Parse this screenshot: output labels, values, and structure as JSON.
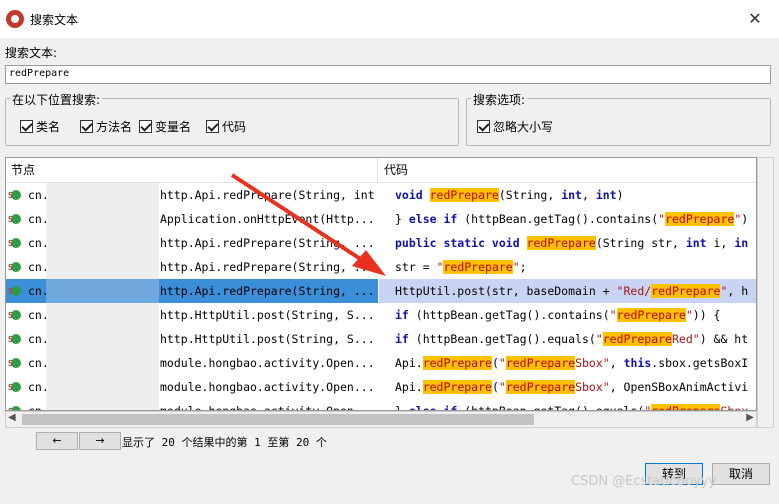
{
  "window": {
    "title": "搜索文本",
    "close_glyph": "✕",
    "icon": "jadx-app-icon"
  },
  "search": {
    "label": "搜索文本:",
    "value": "redPrepare"
  },
  "location_group": {
    "legend": "在以下位置搜索:",
    "options": [
      {
        "label": "类名",
        "checked": true
      },
      {
        "label": "方法名",
        "checked": true
      },
      {
        "label": "变量名",
        "checked": true
      },
      {
        "label": "代码",
        "checked": true
      }
    ]
  },
  "options_group": {
    "legend": "搜索选项:",
    "options": [
      {
        "label": "忽略大小写",
        "checked": true
      }
    ]
  },
  "results": {
    "col_node": "节点",
    "col_code": "代码",
    "rows": [
      {
        "prefix": "cn.",
        "method": "http.Api.redPrepare(String, int",
        "code": [
          [
            "kw",
            "void "
          ],
          [
            "hl",
            "redPrepare"
          ],
          [
            "t",
            "(String, "
          ],
          [
            "kw",
            "int"
          ],
          [
            "t",
            ", "
          ],
          [
            "kw",
            "int"
          ],
          [
            "t",
            ")"
          ]
        ]
      },
      {
        "prefix": "cn.",
        "method": "Application.onHttpEvent(Http...",
        "code": [
          [
            "t",
            "} "
          ],
          [
            "kw",
            "else if"
          ],
          [
            "t",
            " (httpBean.getTag().contains("
          ],
          [
            "str",
            "\""
          ],
          [
            "hl",
            "redPrepare"
          ],
          [
            "str",
            "\""
          ],
          [
            "t",
            ")"
          ]
        ]
      },
      {
        "prefix": "cn.",
        "method": "http.Api.redPrepare(String, ...",
        "code": [
          [
            "kw",
            "public static void "
          ],
          [
            "hl",
            "redPrepare"
          ],
          [
            "t",
            "(String str, "
          ],
          [
            "kw",
            "int"
          ],
          [
            "t",
            " i, "
          ],
          [
            "kw",
            "in"
          ]
        ]
      },
      {
        "prefix": "cn.",
        "method": "http.Api.redPrepare(String, ...",
        "code": [
          [
            "t",
            "str = "
          ],
          [
            "str",
            "\""
          ],
          [
            "hl",
            "redPrepare"
          ],
          [
            "str",
            "\""
          ],
          [
            "t",
            ";"
          ]
        ]
      },
      {
        "prefix": "cn.",
        "method": "http.Api.redPrepare(String, ...",
        "selected": true,
        "code": [
          [
            "t",
            "HttpUtil.post(str, baseDomain + "
          ],
          [
            "str",
            "\"Red/"
          ],
          [
            "hl",
            "redPrepare"
          ],
          [
            "str",
            "\""
          ],
          [
            "t",
            ", h"
          ]
        ]
      },
      {
        "prefix": "cn.",
        "method": "http.HttpUtil.post(String, S...",
        "code": [
          [
            "kw",
            "if"
          ],
          [
            "t",
            " (httpBean.getTag().contains("
          ],
          [
            "str",
            "\""
          ],
          [
            "hl",
            "redPrepare"
          ],
          [
            "str",
            "\""
          ],
          [
            "t",
            ")) {"
          ]
        ]
      },
      {
        "prefix": "cn.",
        "method": "http.HttpUtil.post(String, S...",
        "code": [
          [
            "kw",
            "if"
          ],
          [
            "t",
            " (httpBean.getTag().equals("
          ],
          [
            "str",
            "\""
          ],
          [
            "hl",
            "redPrepare"
          ],
          [
            "str",
            "Red\""
          ],
          [
            "t",
            ") && ht"
          ]
        ]
      },
      {
        "prefix": "cn.",
        "method": "module.hongbao.activity.Open...",
        "code": [
          [
            "t",
            "Api."
          ],
          [
            "hl",
            "redPrepare"
          ],
          [
            "t",
            "("
          ],
          [
            "str",
            "\""
          ],
          [
            "hl",
            "redPrepare"
          ],
          [
            "str",
            "Sbox\""
          ],
          [
            "t",
            ", "
          ],
          [
            "kw",
            "this"
          ],
          [
            "t",
            ".sbox.getsBoxI"
          ]
        ]
      },
      {
        "prefix": "cn.",
        "method": "module.hongbao.activity.Open...",
        "code": [
          [
            "t",
            "Api."
          ],
          [
            "hl",
            "redPrepare"
          ],
          [
            "t",
            "("
          ],
          [
            "str",
            "\""
          ],
          [
            "hl",
            "redPrepare"
          ],
          [
            "str",
            "Sbox\""
          ],
          [
            "t",
            ", OpenSBoxAnimActivi"
          ]
        ]
      },
      {
        "prefix": "cn.",
        "method": "module.hongbao.activity.Open...",
        "code": [
          [
            "t",
            "} "
          ],
          [
            "kw",
            "else if"
          ],
          [
            "t",
            " (httpBean.getTag().equals("
          ],
          [
            "str",
            "\""
          ],
          [
            "hl",
            "redPrepare"
          ],
          [
            "str",
            "Sbox"
          ]
        ]
      }
    ]
  },
  "nav": {
    "prev": "←",
    "next": "→",
    "status": "显示了 20 个结果中的第 1 至第 20 个"
  },
  "buttons": {
    "goto": "转到",
    "cancel": "取消"
  },
  "watermark": "CSDN @EcstaticBoyyy",
  "colors": {
    "highlight_bg": "#ffc200",
    "highlight_fg": "#c00000",
    "selection_node": "#3b8ed8",
    "selection_code": "#c9d4f4",
    "arrow": "#e8321e"
  }
}
